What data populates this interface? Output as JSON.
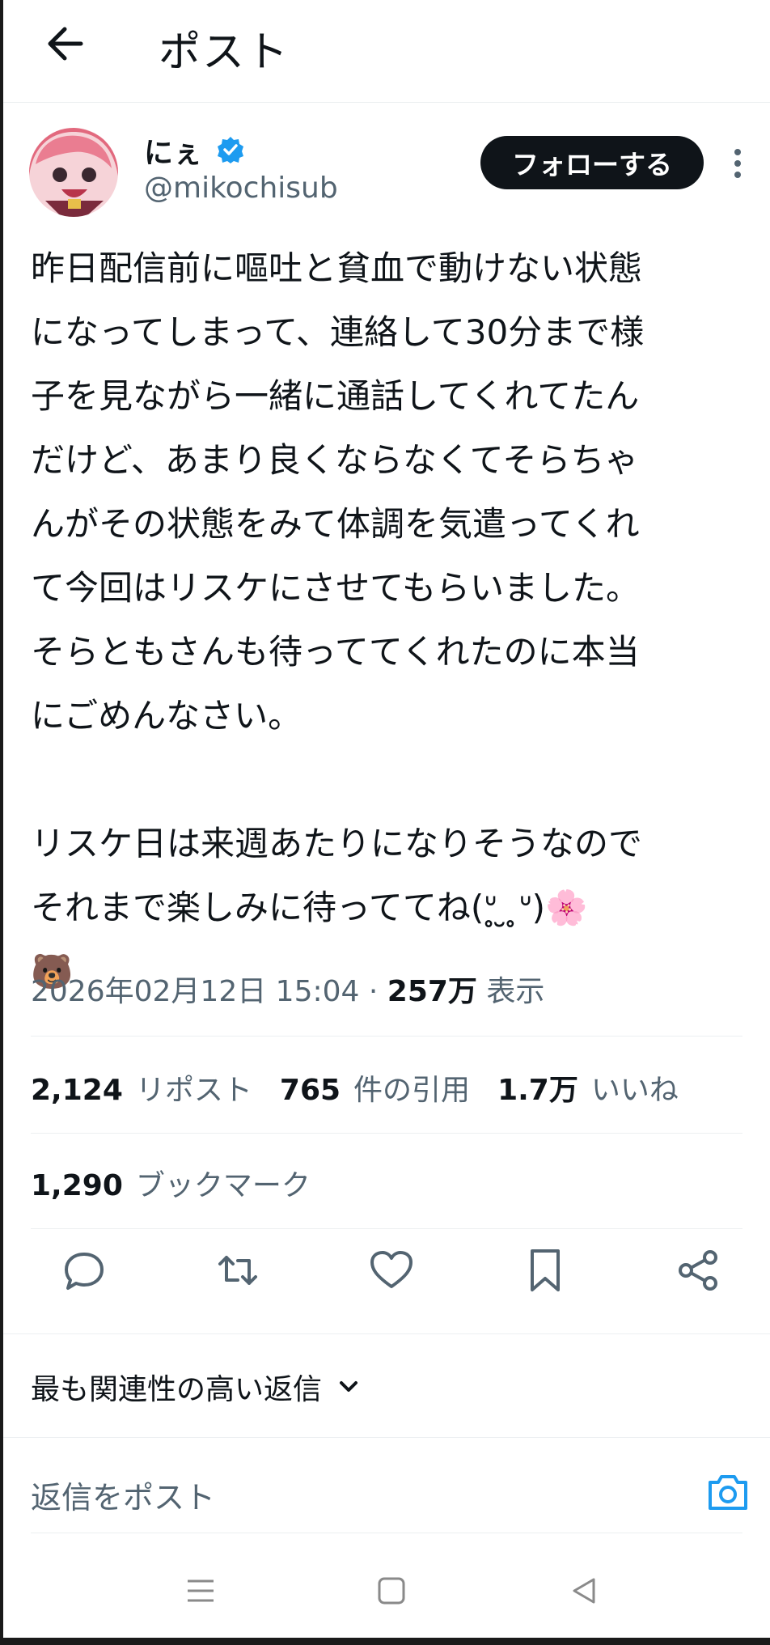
{
  "header": {
    "title": "ポスト"
  },
  "author": {
    "name": "にぇ",
    "handle": "@mikochisub",
    "follow_label": "フォローする"
  },
  "post": {
    "text": "昨日配信前に嘔吐と貧血で動けない状態\nになってしまって、連絡して30分まで様\n子を見ながら一緒に通話してくれてたん\nだけど、あまり良くならなくてそらちゃ\nんがその状態をみて体調を気遣ってくれ\nて今回はリスケにさせてもらいました。\nそらともさんも待っててくれたのに本当\nにごめんなさい。\n\nリスケ日は来週あたりになりそうなので\nそれまで楽しみに待っててね(ᐡ̥ ̮ ̥ᐡ)🌸\n🐻",
    "timestamp": "2026年02月12日 15:04 · ",
    "views": "257万",
    "views_label": " 表示"
  },
  "stats": {
    "reposts": "2,124",
    "reposts_label": "リポスト",
    "quotes": "765",
    "quotes_label": "件の引用",
    "likes": "1.7万",
    "likes_label": "いいね",
    "bookmarks": "1,290",
    "bookmarks_label": "ブックマーク"
  },
  "replies": {
    "sort_label": "最も関連性の高い返信",
    "input_placeholder": "返信をポスト"
  },
  "colors": {
    "accent": "#1d9bf0",
    "text": "#0f1419",
    "secondary": "#536471"
  },
  "icons": [
    "back-arrow-icon",
    "verified-badge-icon",
    "more-icon",
    "reply-icon",
    "repost-icon",
    "like-icon",
    "bookmark-icon",
    "share-icon",
    "chevron-down-icon",
    "camera-icon"
  ]
}
